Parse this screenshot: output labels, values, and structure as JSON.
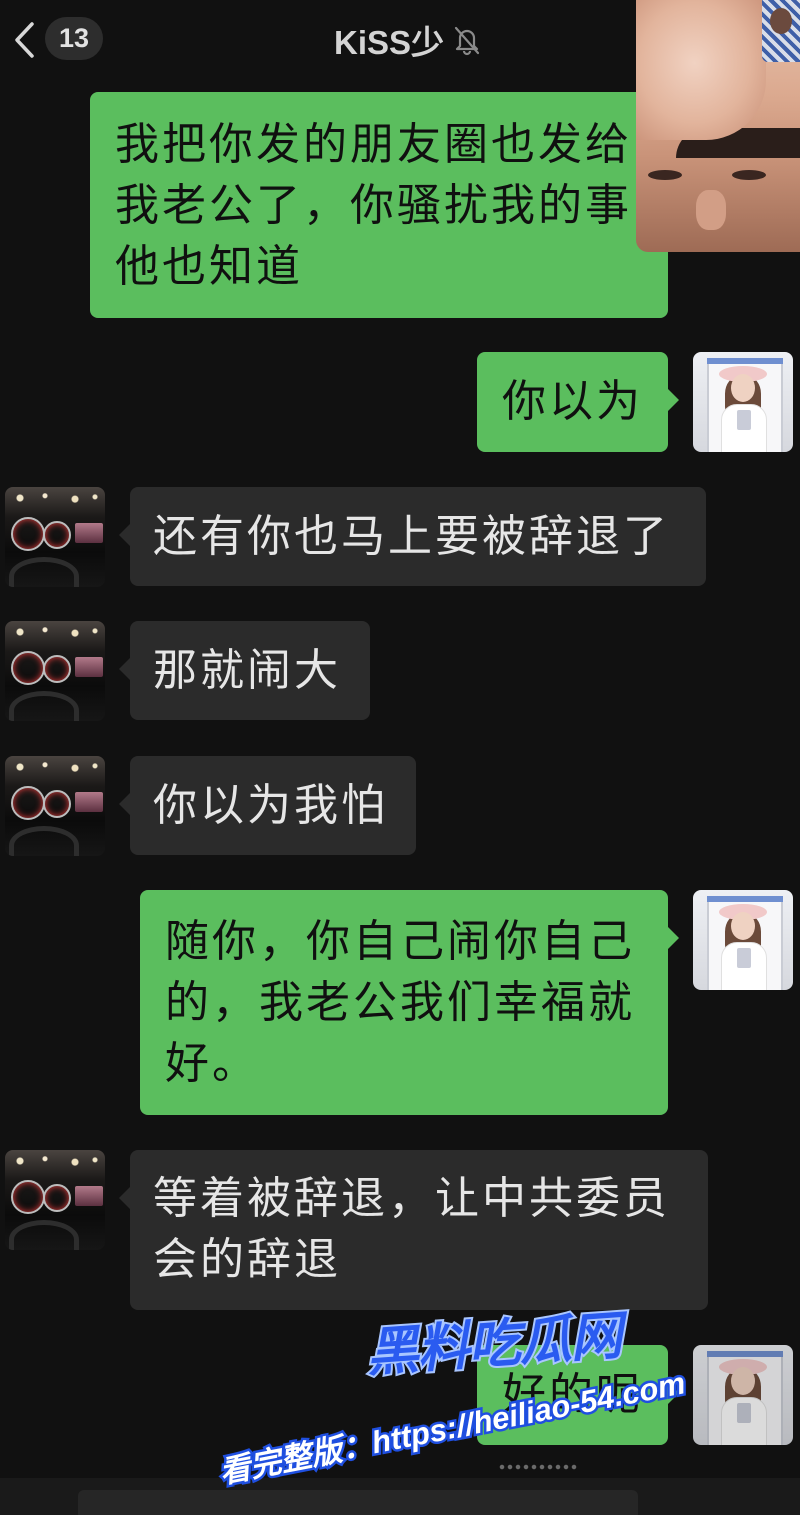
{
  "header": {
    "back_icon": "chevron-left-icon",
    "unread_count": "13",
    "title": "KiSS少",
    "mute_icon": "bell-off-icon"
  },
  "messages": [
    {
      "lines": [
        "我把你发的朋友圈也发给",
        "我老公了，你骚扰我的事",
        "他也知道"
      ]
    },
    {
      "lines": [
        "你以为"
      ]
    },
    {
      "lines": [
        "还有你也马上要被辞退了"
      ]
    },
    {
      "lines": [
        "那就闹大"
      ]
    },
    {
      "lines": [
        "你以为我怕"
      ]
    },
    {
      "lines": [
        "随你，你自己闹你自己",
        "的，我老公我们幸福就",
        "好。"
      ]
    },
    {
      "lines": [
        "等着被辞退，让中共委员",
        "会的辞退"
      ]
    },
    {
      "lines": [
        "好的呢"
      ]
    }
  ],
  "watermark": {
    "brand": "黑料吃瓜网",
    "cta": "看完整版：https://heiliao-54.com"
  },
  "colors": {
    "background": "#111111",
    "outgoing_bubble": "#5bbe5e",
    "incoming_bubble": "#2b2b2b",
    "watermark_blue": "#2a5bf0"
  }
}
